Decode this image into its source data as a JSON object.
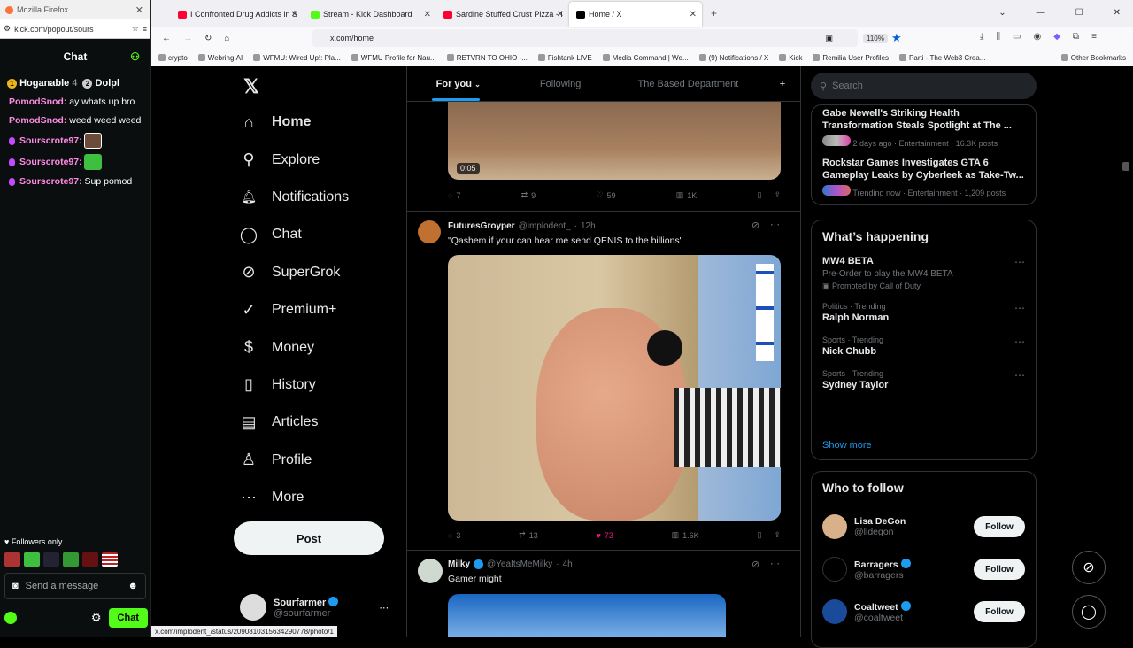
{
  "kick": {
    "window_title": "Mozilla Firefox",
    "url": "kick.com/popout/sours",
    "header": "Chat",
    "gifters": [
      {
        "rank": "1",
        "name": "Hoganable",
        "count": "4"
      },
      {
        "rank": "2",
        "name": "Dolpl"
      }
    ],
    "messages": [
      {
        "user": "PomodSnod:",
        "text": "ay whats up bro",
        "color": "#ff8ae5"
      },
      {
        "user": "PomodSnod:",
        "text": "weed weed weed",
        "color": "#ff8ae5"
      },
      {
        "user": "Sourscrote97:",
        "text": "",
        "color": "#ff8ae5"
      },
      {
        "user": "Sourscrote97:",
        "text": "",
        "color": "#ff8ae5"
      },
      {
        "user": "Sourscrote97:",
        "text": "Sup pomod",
        "color": "#ff8ae5"
      }
    ],
    "followers_only": "Followers only",
    "send_placeholder": "Send a message",
    "chat_button": "Chat"
  },
  "browser": {
    "tabs": [
      {
        "label": "I Confronted Drug Addicts in Se",
        "color": "#ff0033"
      },
      {
        "label": "Stream - Kick Dashboard",
        "color": "#53fc18"
      },
      {
        "label": "Sardine Stuffed Crust Pizza - Kir",
        "color": "#ff0033"
      },
      {
        "label": "Home / X",
        "color": "#000000"
      }
    ],
    "address": "x.com/home",
    "zoom": "110%",
    "bookmarks": [
      "crypto",
      "Webring.AI",
      "WFMU: Wired Up!: Pla...",
      "WFMU Profile for Nau...",
      "RETVRN TO OHIO -...",
      "Fishtank LIVE",
      "Media Command | We...",
      "(9) Notifications / X",
      "Kick",
      "Remilia User Profiles",
      "Parti - The Web3 Crea...",
      "Other Bookmarks"
    ],
    "status_url": "x.com/implodent_/status/2090810315634290778/photo/1"
  },
  "nav": {
    "items": [
      {
        "label": "Home",
        "icon": "home-icon",
        "glyph": "⌂"
      },
      {
        "label": "Explore",
        "icon": "search-icon",
        "glyph": "⚲"
      },
      {
        "label": "Notifications",
        "icon": "bell-icon",
        "glyph": "🔔"
      },
      {
        "label": "Chat",
        "icon": "chat-icon",
        "glyph": "◯"
      },
      {
        "label": "SuperGrok",
        "icon": "grok-icon",
        "glyph": "⊘"
      },
      {
        "label": "Premium+",
        "icon": "premium-icon",
        "glyph": "✓"
      },
      {
        "label": "Money",
        "icon": "money-icon",
        "glyph": "$"
      },
      {
        "label": "History",
        "icon": "bookmark-icon",
        "glyph": "▯"
      },
      {
        "label": "Articles",
        "icon": "articles-icon",
        "glyph": "▤"
      },
      {
        "label": "Profile",
        "icon": "profile-icon",
        "glyph": "♙"
      },
      {
        "label": "More",
        "icon": "more-icon",
        "glyph": "⋯"
      }
    ],
    "post_button": "Post",
    "account": {
      "name": "Sourfarmer",
      "handle": "@sourfarmer"
    }
  },
  "feed": {
    "tabs": [
      "For you",
      "Following",
      "The Based Department"
    ],
    "video_time": "0:05",
    "post1_actions": {
      "replies": "7",
      "reposts": "9",
      "likes": "59",
      "views": "1K"
    },
    "post2": {
      "name": "FuturesGroyper",
      "handle": "@implodent_",
      "time": "12h",
      "text": "\"Qashem if your can hear me send QENIS to the billions\"",
      "actions": {
        "replies": "3",
        "reposts": "13",
        "likes": "73",
        "views": "1.6K"
      }
    },
    "post3": {
      "name": "Milky",
      "handle": "@YeaItsMeMilky",
      "time": "4h",
      "text": "Gamer might"
    }
  },
  "right": {
    "search_placeholder": "Search",
    "news": [
      {
        "title": "Gabe Newell's Striking Health Transformation Steals Spotlight at The ...",
        "meta": "2 days ago · Entertainment · 16.3K posts"
      },
      {
        "title": "Rockstar Games Investigates GTA 6 Gameplay Leaks by Cyberleek as Take-Tw...",
        "meta": "Trending now · Entertainment · 1,209 posts"
      }
    ],
    "happening_title": "What’s happening",
    "trends": [
      {
        "meta": "",
        "name": "MW4 BETA",
        "sub": "Pre-Order to play the MW4 BETA",
        "promo": "Promoted by Call of Duty"
      },
      {
        "meta": "Politics · Trending",
        "name": "Ralph Norman"
      },
      {
        "meta": "Sports · Trending",
        "name": "Nick Chubb"
      },
      {
        "meta": "Sports · Trending",
        "name": "Sydney Taylor"
      }
    ],
    "show_more": "Show more",
    "who_to_follow": "Who to follow",
    "follow": [
      {
        "name": "Lisa DeGon",
        "handle": "@lldegon",
        "verified": false
      },
      {
        "name": "Barragers",
        "handle": "@barragers",
        "verified": true
      },
      {
        "name": "Coaltweet",
        "handle": "@coaltweet",
        "verified": true
      }
    ],
    "follow_label": "Follow"
  },
  "colors": {
    "accent": "#1d9bf0",
    "like": "#f91880",
    "kick_green": "#53fc18"
  }
}
